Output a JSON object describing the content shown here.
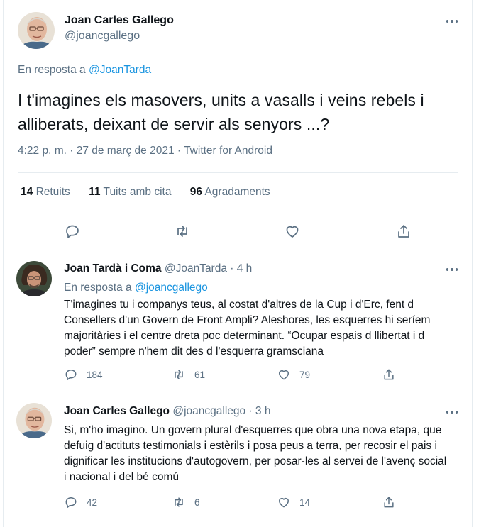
{
  "main_tweet": {
    "author_name": "Joan Carles Gallego",
    "author_handle": "@joancgallego",
    "reply_prefix": "En resposta a",
    "reply_to": "@JoanTarda",
    "text": "I t'imagines els masovers, units a vasalls i veins rebels i alliberats, deixant de servir als senyors ...?",
    "timestamp": "4:22 p. m. · 27 de març de 2021 · Twitter for Android",
    "stats": [
      {
        "count": "14",
        "label": "Retuits"
      },
      {
        "count": "11",
        "label": "Tuits amb cita"
      },
      {
        "count": "96",
        "label": "Agradaments"
      }
    ]
  },
  "replies": [
    {
      "author_name": "Joan Tardà i Coma",
      "author_handle": "@JoanTarda",
      "time": "· 4 h",
      "reply_prefix": "En resposta a",
      "reply_to": "@joancgallego",
      "text": "T'imagines tu i companys teus, al costat d'altres de la Cup i d'Erc, fent d Consellers d'un Govern de Front Ampli? Aleshores, les esquerres hi seríem majoritàries i el centre dreta poc determinant. “Ocupar espais d llibertat i d poder” sempre n'hem dit des d l'esquerra gramsciana",
      "reply_count": "184",
      "retweet_count": "61",
      "like_count": "79"
    },
    {
      "author_name": "Joan Carles Gallego",
      "author_handle": "@joancgallego",
      "time": "· 3 h",
      "text": "Si, m'ho imagino. Un govern plural d'esquerres que obra una nova etapa, que defuig d'actituts testimonials i estèrils i posa peus a terra, per recosir el pais i dignificar les institucions d'autogovern, per posar-les al servei de l'avenç social i nacional i del bé comú",
      "reply_count": "42",
      "retweet_count": "6",
      "like_count": "14"
    }
  ],
  "icons": {
    "reply": "reply-icon",
    "retweet": "retweet-icon",
    "like": "heart-icon",
    "share": "share-icon",
    "more": "more-icon"
  },
  "colors": {
    "link": "#1b95e0",
    "secondary_text": "#5b7083",
    "border": "#e6ecf0"
  }
}
